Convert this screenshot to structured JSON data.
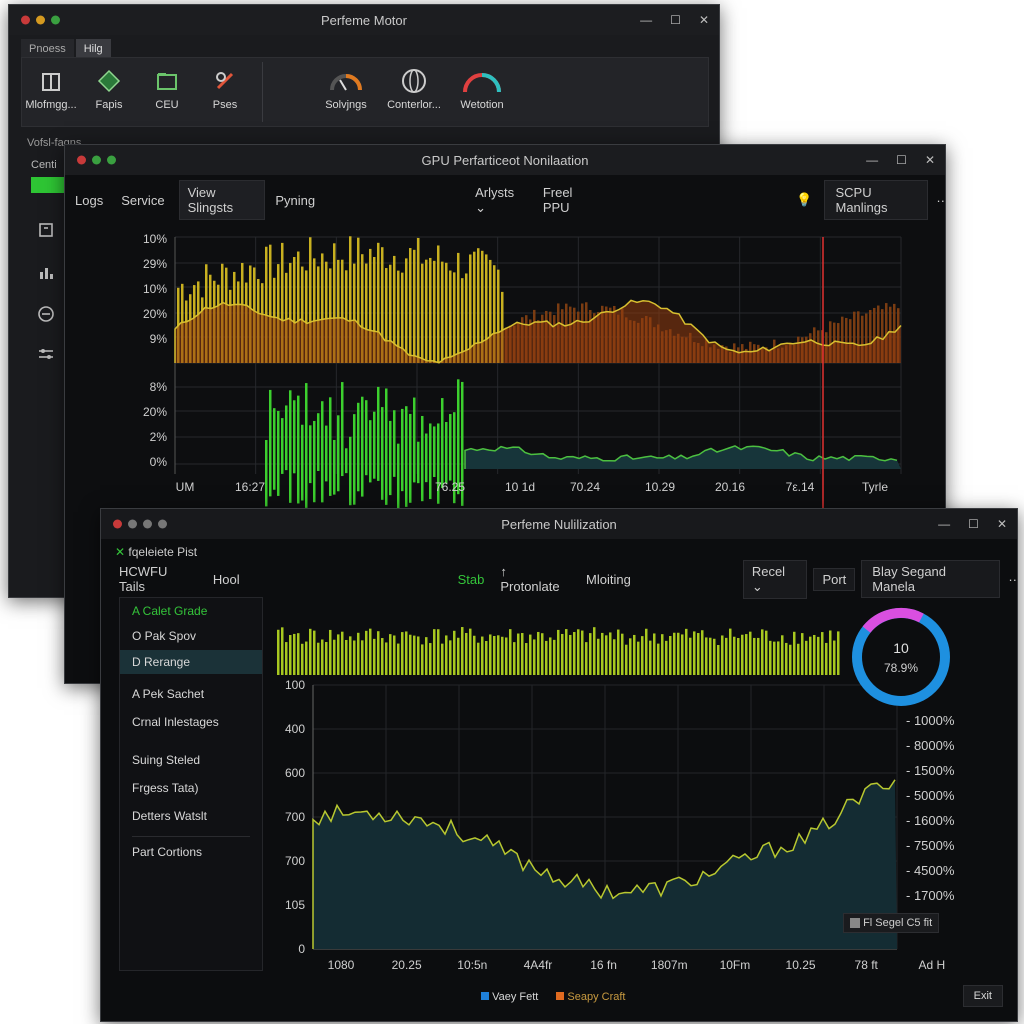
{
  "colors": {
    "green": "#34c43a",
    "yellow": "#c8b020",
    "orange": "#c05a16",
    "teal": "#1d3a3c",
    "red": "#e03030",
    "ring_blue": "#1e90e0",
    "ring_pink": "#d94fe0"
  },
  "back_window": {
    "title": "Perfeme Motor",
    "tabs": [
      "Pnoess",
      "Hilg"
    ],
    "tools": [
      {
        "label": "Mlofmgg...",
        "icon": "box-icon"
      },
      {
        "label": "Fapis",
        "icon": "diamond-icon"
      },
      {
        "label": "CEU",
        "icon": "folder-icon"
      },
      {
        "label": "Pses",
        "icon": "wrench-icon"
      },
      {
        "label": "Solvjngs",
        "icon": "gauge-icon"
      },
      {
        "label": "Conterlor...",
        "icon": "globe-icon"
      },
      {
        "label": "Wetotion",
        "icon": "ring-gauge-icon"
      }
    ],
    "section_label": "Vofsl-fagns",
    "sub_label": "Centi",
    "side_icons": [
      "archive-icon",
      "bar-chart-icon",
      "circle-icon",
      "sliders-icon"
    ]
  },
  "middle_window": {
    "title": "GPU Perfarticeot Nonilaation",
    "toolbar": {
      "logs": "Logs",
      "service": "Service",
      "view": "View Slingsts",
      "pyning": "Pyning",
      "artysts": "Arlysts",
      "freel": "Freel PPU",
      "monitor": "SCPU Manlings",
      "more": "··"
    },
    "chart_top": {
      "y_ticks": [
        "10%",
        "29%",
        "10%",
        "20%",
        "9%"
      ]
    },
    "chart_bottom": {
      "y_ticks": [
        "8%",
        "20%",
        "2%",
        "0%"
      ]
    },
    "x_ticks": [
      "UM",
      "16:27",
      "76.25",
      "10 1d",
      "70.24",
      "10.29",
      "20.16",
      "7ε.14",
      "Tyrle"
    ]
  },
  "front_window": {
    "title": "Perfeme Nulilization",
    "subheader": "fqeleiete Pist",
    "toolbar": {
      "hcwfu": "HCWFU Tails",
      "hool": "Hool",
      "stab": "Stab",
      "protonlate": "↑ Protonlate",
      "mloiting": "Mloiting",
      "recel": "Recel",
      "port": "Port",
      "blay": "Blay Segand Manela",
      "more": "··"
    },
    "side_items": [
      "A Calet Grade",
      "O Pak Spov",
      "D Rerange",
      "A Pek Sachet",
      "Crnal Inlestages",
      "Suing Steled",
      "Frgess Tata)",
      "Detters Watslt",
      "Part Cortions"
    ],
    "donut": {
      "line1": "10",
      "line2": "78.9%",
      "value": 0.78
    },
    "y_left_ticks": [
      "100",
      "400",
      "600",
      "700",
      "700",
      "105",
      "0"
    ],
    "y_right_ticks": [
      "1000%",
      "8000%",
      "1500%",
      "5000%",
      "1600%",
      "7500%",
      "4500%",
      "1700%"
    ],
    "x_ticks": [
      "1080",
      "20.25",
      "10:5n",
      "4A4fr",
      "16 fn",
      "1807m",
      "10Fm",
      "10.25",
      "78 ft",
      "Ad H"
    ],
    "badge": "Fl Segel C5 fit",
    "legend": [
      {
        "label": "Vaey Fett",
        "color": "#1e7fd8"
      },
      {
        "label": "Seapy Craft",
        "color": "#e06a20"
      }
    ],
    "exit_button": "Exit"
  }
}
